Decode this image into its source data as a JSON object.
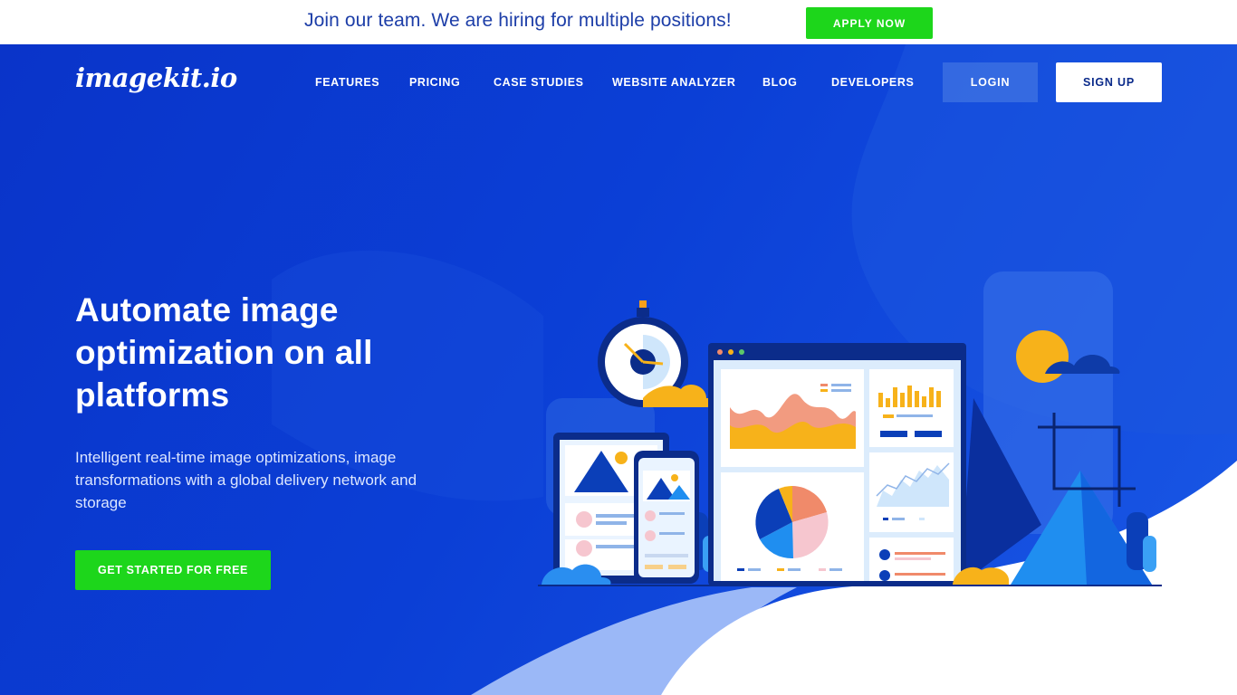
{
  "banner": {
    "text": "Join our team. We are hiring for multiple positions!",
    "apply_label": "APPLY NOW"
  },
  "header": {
    "logo": "imagekit.io",
    "nav": [
      {
        "label": "FEATURES"
      },
      {
        "label": "PRICING"
      },
      {
        "label": "CASE STUDIES"
      },
      {
        "label": "WEBSITE ANALYZER"
      },
      {
        "label": "BLOG"
      },
      {
        "label": "DEVELOPERS"
      }
    ],
    "login_label": "LOGIN",
    "signup_label": "SIGN UP"
  },
  "hero": {
    "headline": "Automate image optimization on all platforms",
    "subheadline": "Intelligent real-time image optimizations, image transformations with a global delivery network and storage",
    "cta_label": "GET STARTED FOR FREE"
  },
  "colors": {
    "primary_blue": "#0b3fd6",
    "accent_green": "#1dd61b",
    "banner_text": "#1d3ea8"
  }
}
